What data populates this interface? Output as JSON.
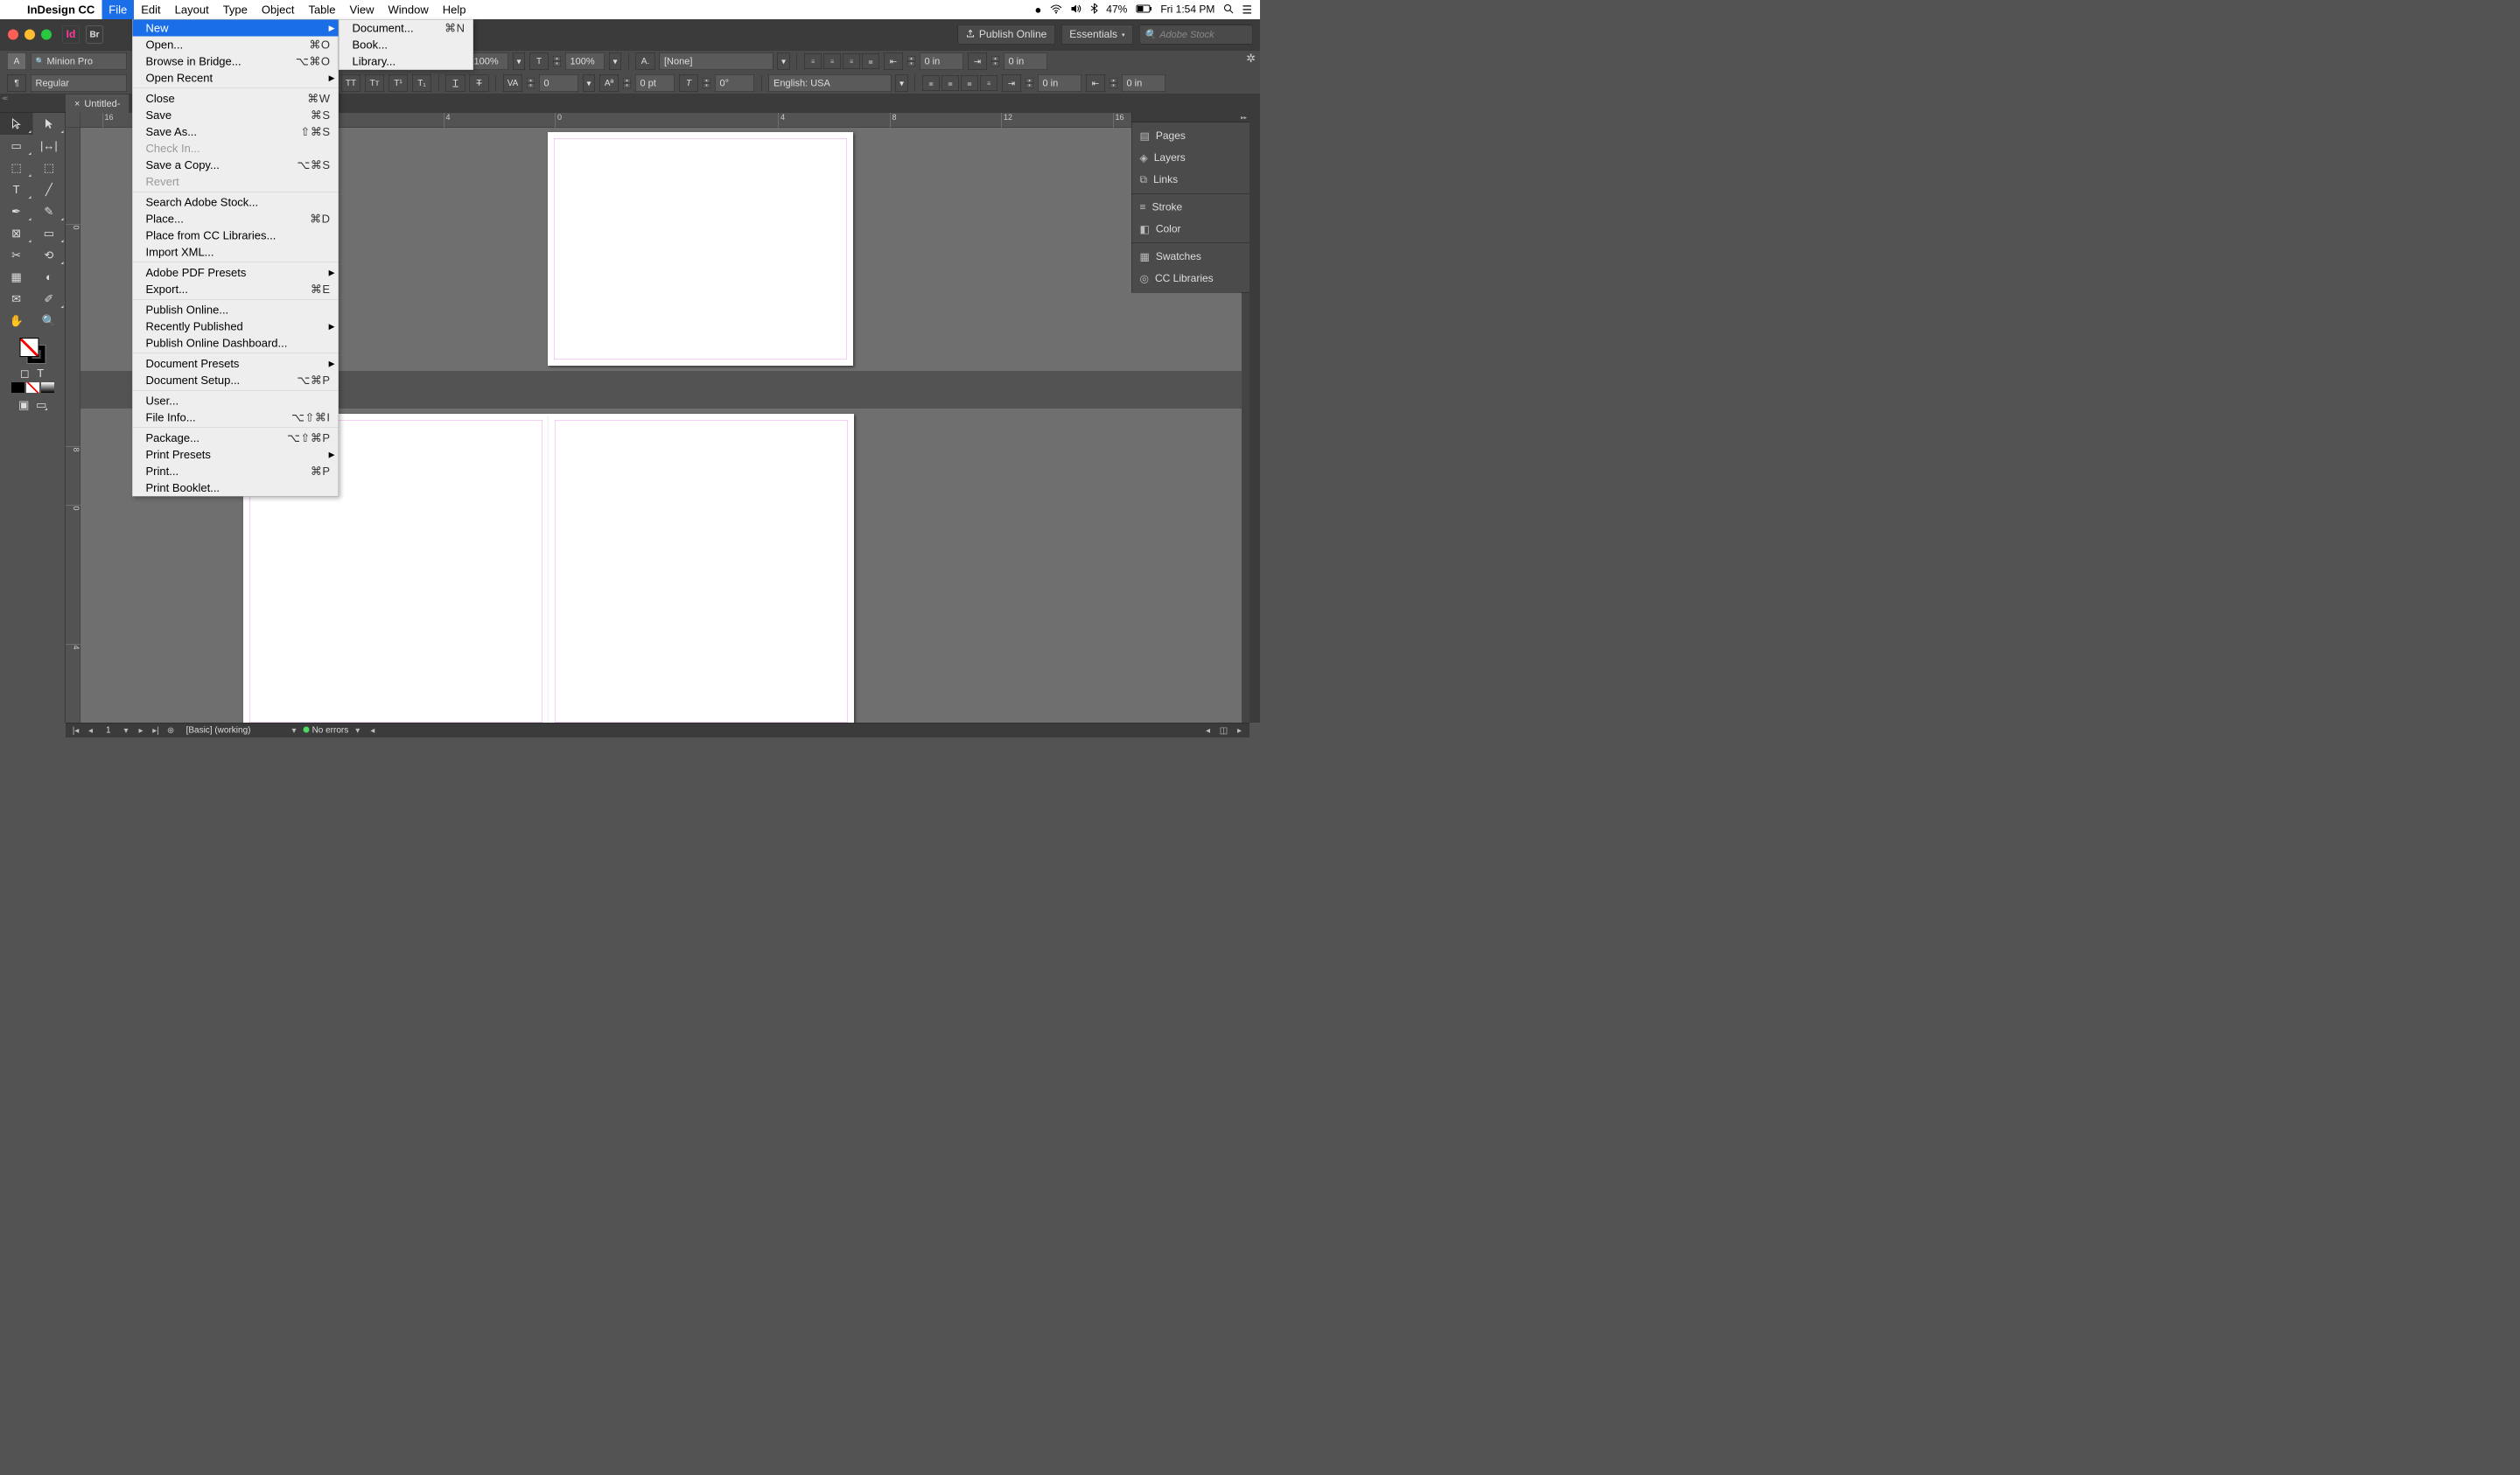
{
  "mac_menubar": {
    "app": "InDesign CC",
    "items": [
      "File",
      "Edit",
      "Layout",
      "Type",
      "Object",
      "Table",
      "View",
      "Window",
      "Help"
    ],
    "active_index": 0,
    "right": {
      "battery": "47%",
      "datetime": "Fri 1:54 PM"
    }
  },
  "window_bar": {
    "publish_label": "Publish Online",
    "workspace_label": "Essentials",
    "stock_placeholder": "Adobe Stock"
  },
  "control_bar": {
    "font_family": "Minion Pro",
    "font_style": "Regular",
    "h_scale": "100%",
    "v_scale": "100%",
    "char_style": "[None]",
    "tracking": "0",
    "baseline": "0 pt",
    "skew": "0°",
    "language": "English: USA",
    "indent_l": "0 in",
    "indent_r": "0 in",
    "indent_fl": "0 in",
    "indent_ll": "0 in"
  },
  "file_menu": [
    {
      "label": "New",
      "hl": true,
      "sub": true
    },
    {
      "label": "Open...",
      "sc": "⌘O"
    },
    {
      "label": "Browse in Bridge...",
      "sc": "⌥⌘O"
    },
    {
      "label": "Open Recent",
      "sub": true
    },
    {
      "sep": true
    },
    {
      "label": "Close",
      "sc": "⌘W"
    },
    {
      "label": "Save",
      "sc": "⌘S"
    },
    {
      "label": "Save As...",
      "sc": "⇧⌘S"
    },
    {
      "label": "Check In...",
      "dis": true
    },
    {
      "label": "Save a Copy...",
      "sc": "⌥⌘S"
    },
    {
      "label": "Revert",
      "dis": true
    },
    {
      "sep": true
    },
    {
      "label": "Search Adobe Stock..."
    },
    {
      "label": "Place...",
      "sc": "⌘D"
    },
    {
      "label": "Place from CC Libraries..."
    },
    {
      "label": "Import XML..."
    },
    {
      "sep": true
    },
    {
      "label": "Adobe PDF Presets",
      "sub": true
    },
    {
      "label": "Export...",
      "sc": "⌘E"
    },
    {
      "sep": true
    },
    {
      "label": "Publish Online..."
    },
    {
      "label": "Recently Published",
      "sub": true
    },
    {
      "label": "Publish Online Dashboard..."
    },
    {
      "sep": true
    },
    {
      "label": "Document Presets",
      "sub": true
    },
    {
      "label": "Document Setup...",
      "sc": "⌥⌘P"
    },
    {
      "sep": true
    },
    {
      "label": "User..."
    },
    {
      "label": "File Info...",
      "sc": "⌥⇧⌘I"
    },
    {
      "sep": true
    },
    {
      "label": "Package...",
      "sc": "⌥⇧⌘P"
    },
    {
      "label": "Print Presets",
      "sub": true
    },
    {
      "label": "Print...",
      "sc": "⌘P"
    },
    {
      "label": "Print Booklet..."
    }
  ],
  "new_submenu": [
    {
      "label": "Document...",
      "sc": "⌘N"
    },
    {
      "label": "Book..."
    },
    {
      "label": "Library..."
    }
  ],
  "doc_tab": {
    "title": "Untitled-",
    "close": "×"
  },
  "h_ruler_ticks": [
    {
      "pos": 50,
      "label": "16"
    },
    {
      "pos": 830,
      "label": "4"
    },
    {
      "pos": 1085,
      "label": "0"
    },
    {
      "pos": 1595,
      "label": "4"
    },
    {
      "pos": 1850,
      "label": "8"
    },
    {
      "pos": 2105,
      "label": "12"
    },
    {
      "pos": 2360,
      "label": "16"
    }
  ],
  "v_ruler_ticks": [
    {
      "pos": 220,
      "label": "0"
    },
    {
      "pos": 728,
      "label": "8"
    },
    {
      "pos": 862,
      "label": "0"
    },
    {
      "pos": 1180,
      "label": "4"
    }
  ],
  "right_panels": [
    [
      "Pages",
      "Layers",
      "Links"
    ],
    [
      "Stroke",
      "Color"
    ],
    [
      "Swatches",
      "CC Libraries"
    ]
  ],
  "right_panel_icons": {
    "Pages": "▤",
    "Layers": "◈",
    "Links": "⧉",
    "Stroke": "≡",
    "Color": "◧",
    "Swatches": "▦",
    "CC Libraries": "◎"
  },
  "status_bar": {
    "page": "1",
    "preset": "[Basic] (working)",
    "preflight": "No errors"
  }
}
